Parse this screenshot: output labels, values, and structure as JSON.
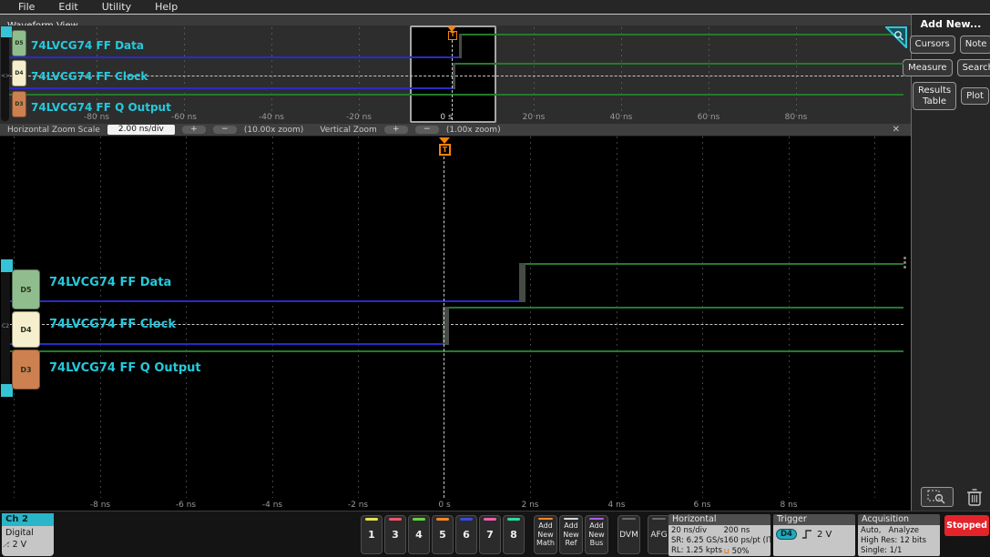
{
  "menu": {
    "items": [
      "File",
      "Edit",
      "Utility",
      "Help"
    ]
  },
  "view_tab": "Waveform View",
  "channels": [
    {
      "badge": "D5",
      "label": "74LVCG74 FF Data",
      "badge_color": "#90bd8e"
    },
    {
      "badge": "D4",
      "label": "74LVCG74 FF Clock",
      "badge_color": "#f6efcd"
    },
    {
      "badge": "D3",
      "label": "74LVCG74 FF Q Output",
      "badge_color": "#cd8050"
    }
  ],
  "overview_axis": [
    "-80 ns",
    "-60 ns",
    "-40 ns",
    "-20 ns",
    "0 s",
    "20 ns",
    "40 ns",
    "60 ns",
    "80 ns"
  ],
  "main_axis": [
    "-8 ns",
    "-6 ns",
    "-4 ns",
    "-2 ns",
    "0 s",
    "2 ns",
    "4 ns",
    "6 ns",
    "8 ns"
  ],
  "trigger_marker": "T",
  "zoom_toolbar": {
    "h_label": "Horizontal Zoom Scale",
    "h_value": "2.00 ns/div",
    "plus": "+",
    "minus": "−",
    "h_zoom": "(10.00x zoom)",
    "v_label": "Vertical Zoom",
    "v_zoom": "(1.00x zoom)",
    "close": "✕"
  },
  "waveforms": {
    "low_color": "#2a2ac8",
    "high_color": "#237a2d",
    "data": {
      "state_before": "low",
      "edge_time": "1.8 ns",
      "state_after": "high"
    },
    "clock": {
      "state_before": "low",
      "edge_time": "0 s",
      "state_after": "high"
    },
    "q_output": {
      "state": "high"
    }
  },
  "right_panel": {
    "title": "Add New...",
    "buttons": [
      "Cursors",
      "Note",
      "Measure",
      "Search",
      "Results\nTable",
      "Plot"
    ]
  },
  "bottom": {
    "channel_badge": {
      "name": "Ch 2",
      "mode": "Digital",
      "threshold_text": ": 2 V"
    },
    "channel_buttons": [
      {
        "label": "1",
        "color": "#e8e44c"
      },
      {
        "label": "3",
        "color": "#f0566a"
      },
      {
        "label": "4",
        "color": "#6ad23a"
      },
      {
        "label": "5",
        "color": "#f0882a"
      },
      {
        "label": "6",
        "color": "#3a4ae0"
      },
      {
        "label": "7",
        "color": "#ee5fae"
      },
      {
        "label": "8",
        "color": "#2fd9a0"
      }
    ],
    "add_buttons": [
      {
        "label": "Add\nNew\nMath",
        "color": "#f0882a"
      },
      {
        "label": "Add\nNew\nRef",
        "color": "#d8d8d8"
      },
      {
        "label": "Add\nNew\nBus",
        "color": "#a95fe8"
      }
    ],
    "dvm": "DVM",
    "afg": "AFG",
    "horizontal": {
      "title": "Horizontal",
      "scale": "20 ns/div",
      "window": "200 ns",
      "sample_rate": "SR: 6.25 GS/s",
      "resolution": "160 ps/pt (IT",
      "record_length": "RL: 1.25 kpts",
      "trigger_position": "50%"
    },
    "trigger": {
      "title": "Trigger",
      "source": "D4",
      "level": "2 V"
    },
    "acquisition": {
      "title": "Acquisition",
      "mode": "Auto,   Analyze",
      "detail": "High Res: 12 bits",
      "single": "Single: 1/1"
    },
    "status": "Stopped"
  },
  "accent_colors": {
    "cyan_label": "#25c9dc",
    "trigger_orange": "#f5820b",
    "stopped_red": "#e3242b"
  }
}
